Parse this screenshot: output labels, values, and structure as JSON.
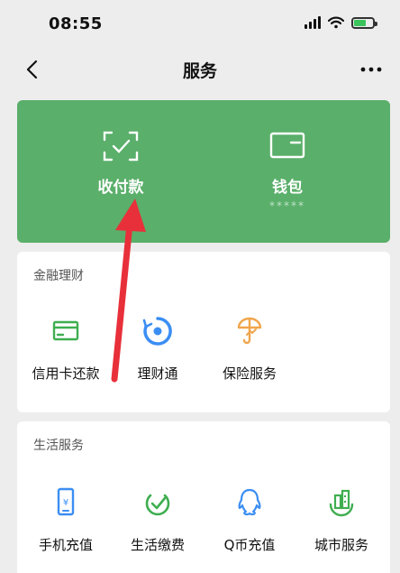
{
  "status_bar": {
    "time": "08:55"
  },
  "nav": {
    "title": "服务"
  },
  "pay_card": {
    "items": [
      {
        "label": "收付款",
        "icon": "scan-pay-icon"
      },
      {
        "label": "钱包",
        "sub": "*****",
        "icon": "wallet-icon"
      }
    ]
  },
  "finance": {
    "title": "金融理财",
    "items": [
      {
        "label": "信用卡还款",
        "icon": "credit-card-icon"
      },
      {
        "label": "理财通",
        "icon": "wealth-icon"
      },
      {
        "label": "保险服务",
        "icon": "insurance-icon"
      }
    ]
  },
  "life": {
    "title": "生活服务",
    "items": [
      {
        "label": "手机充值",
        "icon": "phone-recharge-icon"
      },
      {
        "label": "生活缴费",
        "icon": "utility-payment-icon"
      },
      {
        "label": "Q币充值",
        "icon": "qq-coin-icon"
      },
      {
        "label": "城市服务",
        "icon": "city-service-icon"
      }
    ]
  },
  "colors": {
    "pay_card_bg": "#5aaf6a",
    "icon_green": "#3fae50",
    "icon_blue": "#3b8ef3",
    "icon_orange": "#f0a54b",
    "annotation_arrow": "#e8303a"
  }
}
